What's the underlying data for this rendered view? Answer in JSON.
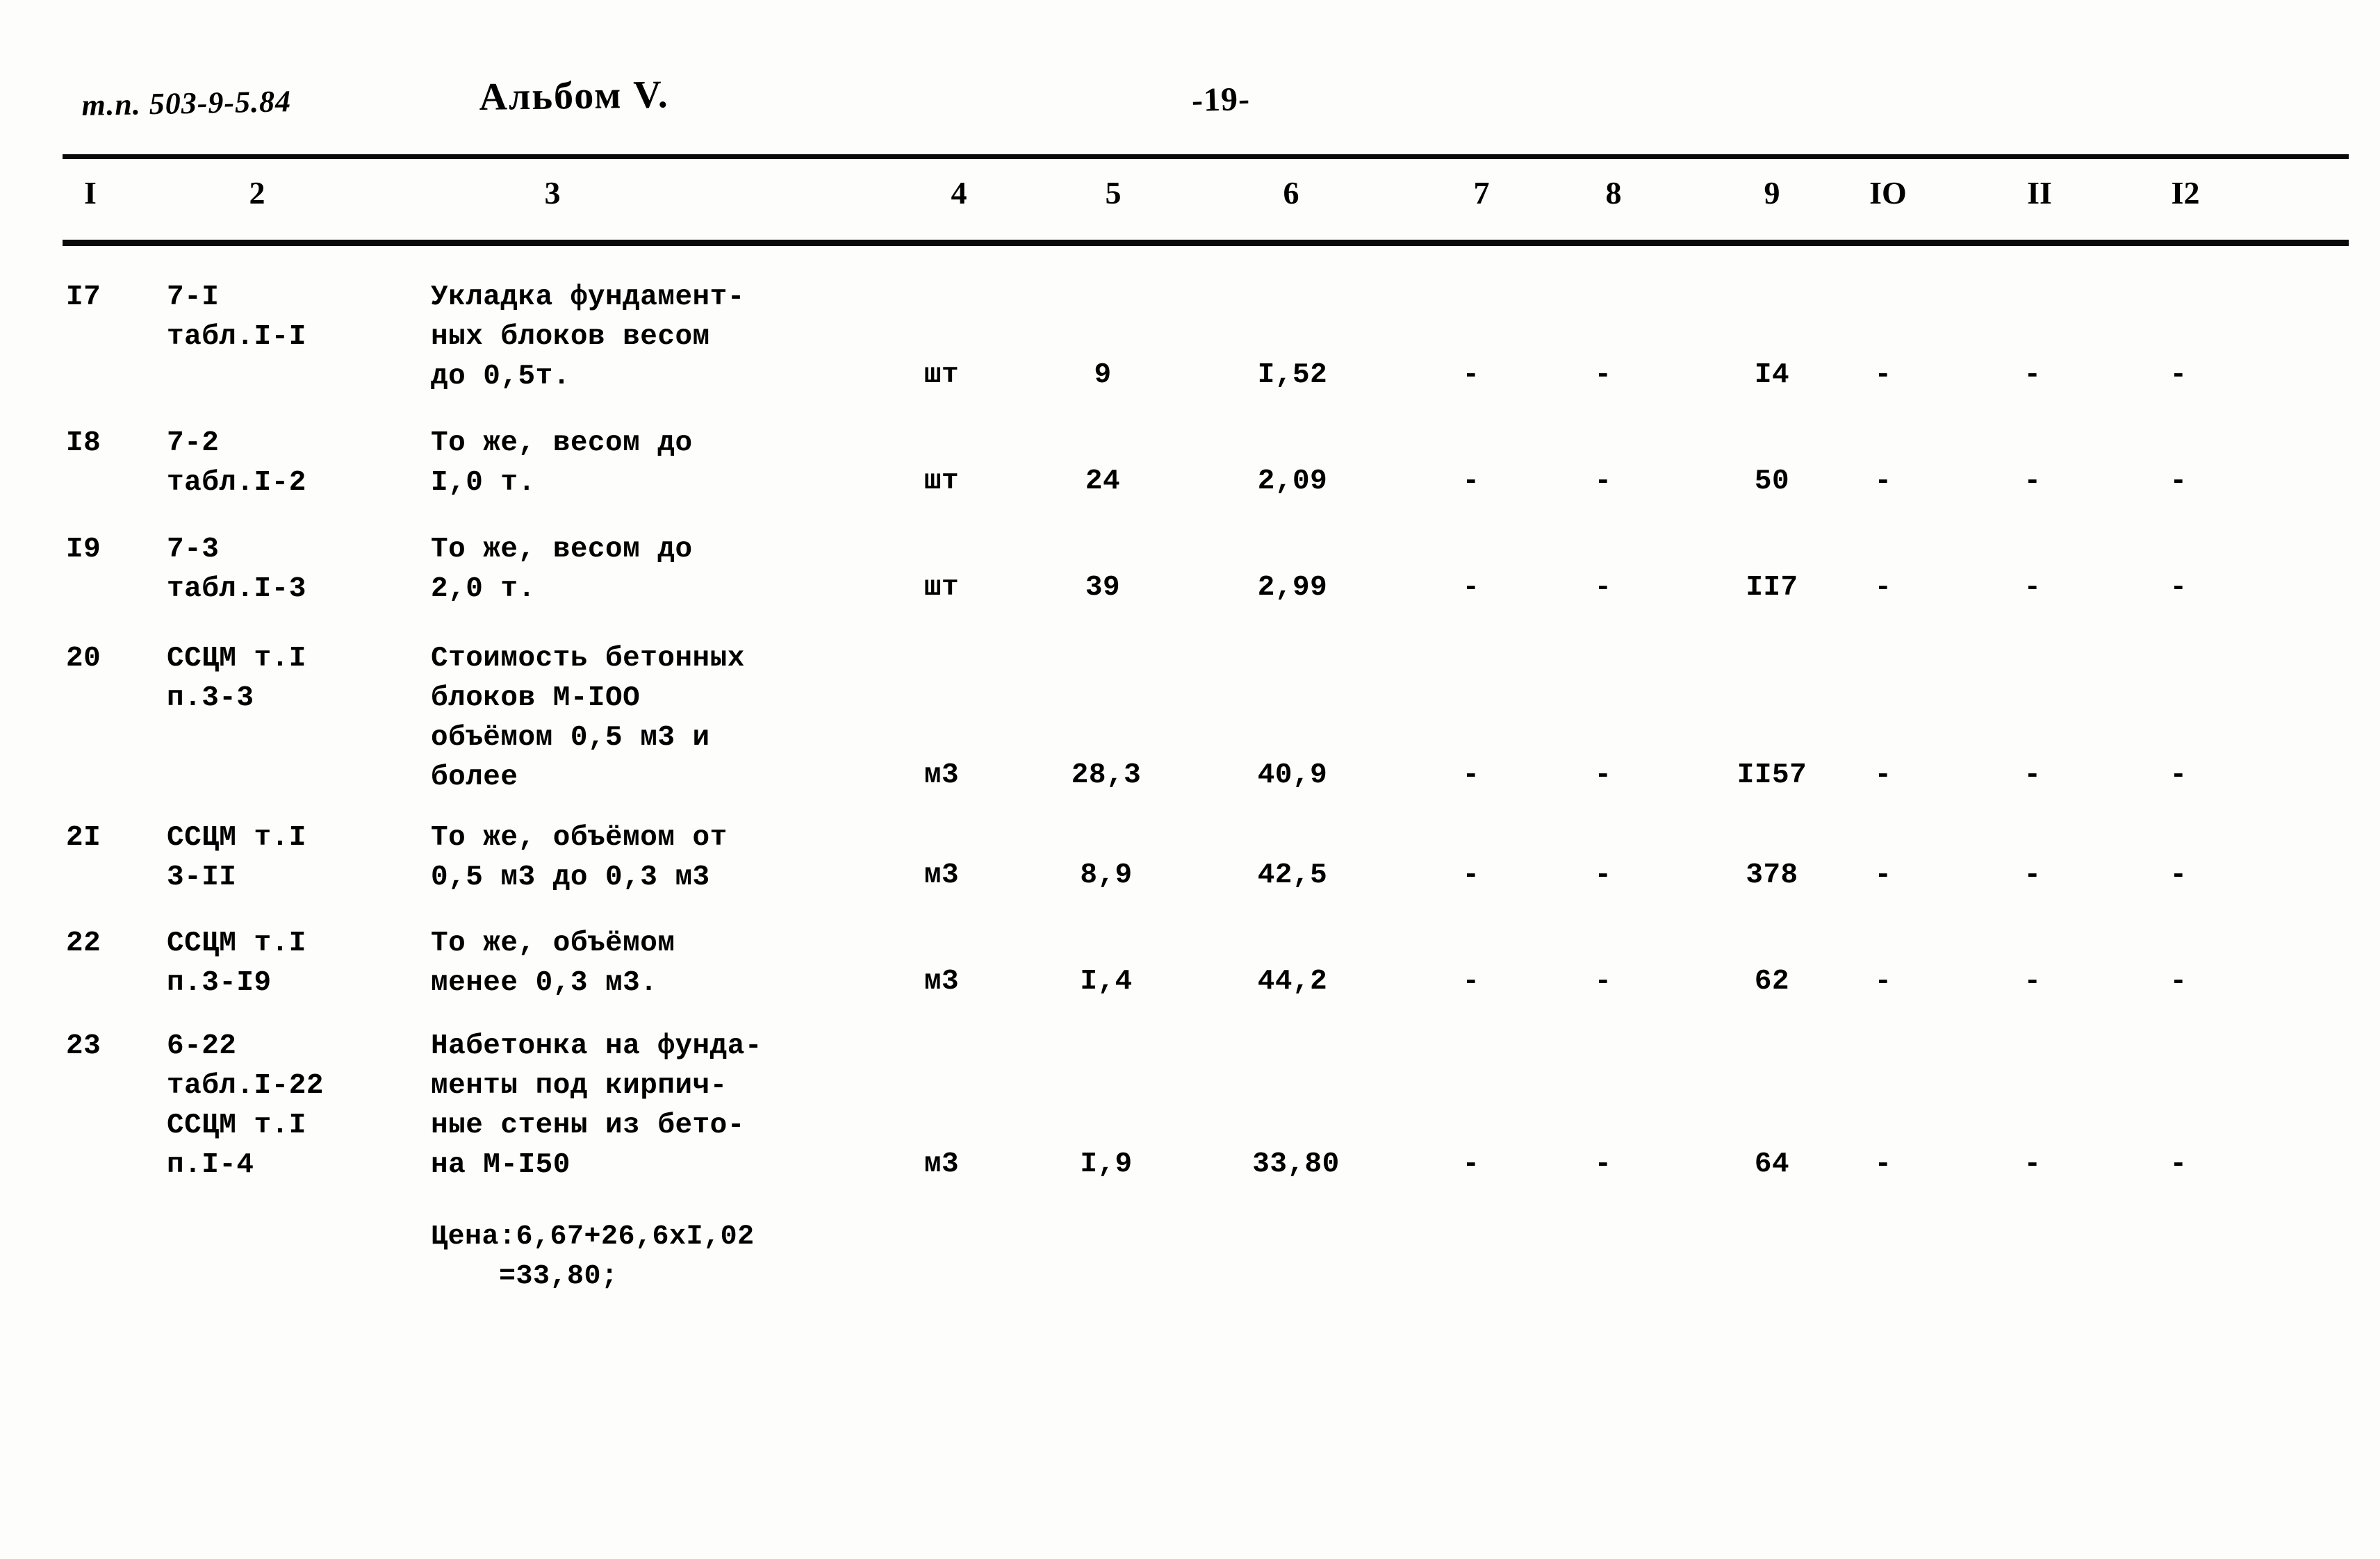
{
  "header": {
    "doc_code": "т.п. 503-9-5.84",
    "album": "Альбом V.",
    "page_number": "-19-"
  },
  "table": {
    "column_headers": [
      "I",
      "2",
      "3",
      "4",
      "5",
      "6",
      "7",
      "8",
      "9",
      "IO",
      "II",
      "I2"
    ],
    "rows": [
      {
        "c1": "I7",
        "c2": [
          "7-I",
          "табл.I-I"
        ],
        "c3": [
          "Укладка фундамент-",
          "ных блоков весом",
          "до 0,5т."
        ],
        "c4": "шт",
        "c5": "9",
        "c6": "I,52",
        "c7": "-",
        "c8": "-",
        "c9": "I4",
        "c10": "-",
        "c11": "-",
        "c12": "-"
      },
      {
        "c1": "I8",
        "c2": [
          "7-2",
          "табл.I-2"
        ],
        "c3": [
          "То же, весом до",
          "I,0 т."
        ],
        "c4": "шт",
        "c5": "24",
        "c6": "2,09",
        "c7": "-",
        "c8": "-",
        "c9": "50",
        "c10": "-",
        "c11": "-",
        "c12": "-"
      },
      {
        "c1": "I9",
        "c2": [
          "7-3",
          "табл.I-3"
        ],
        "c3": [
          "То же, весом до",
          "2,0 т."
        ],
        "c4": "шт",
        "c5": "39",
        "c6": "2,99",
        "c7": "-",
        "c8": "-",
        "c9": "II7",
        "c10": "-",
        "c11": "-",
        "c12": "-"
      },
      {
        "c1": "20",
        "c2": [
          "ССЦМ т.I",
          "п.3-3"
        ],
        "c3": [
          "Стоимость бетонных",
          "блоков М-IOO",
          "объёмом 0,5 м3 и",
          "более"
        ],
        "c4": "м3",
        "c5": "28,3",
        "c6": "40,9",
        "c7": "-",
        "c8": "-",
        "c9": "II57",
        "c10": "-",
        "c11": "-",
        "c12": "-"
      },
      {
        "c1": "2I",
        "c2": [
          "ССЦМ т.I",
          "3-II"
        ],
        "c3": [
          "То же, объёмом от",
          "0,5 м3 до 0,3 м3"
        ],
        "c4": "м3",
        "c5": "8,9",
        "c6": "42,5",
        "c7": "-",
        "c8": "-",
        "c9": "378",
        "c10": "-",
        "c11": "-",
        "c12": "-"
      },
      {
        "c1": "22",
        "c2": [
          "ССЦМ т.I",
          "п.3-I9"
        ],
        "c3": [
          "То же, объёмом",
          "менее 0,3 м3."
        ],
        "c4": "м3",
        "c5": "I,4",
        "c6": "44,2",
        "c7": "-",
        "c8": "-",
        "c9": "62",
        "c10": "-",
        "c11": "-",
        "c12": "-"
      },
      {
        "c1": "23",
        "c2": [
          "6-22",
          "табл.I-22",
          "ССЦМ т.I",
          "п.I-4"
        ],
        "c3": [
          "Набетонка на фунда-",
          "менты под кирпич-",
          "ные стены из бето-",
          "на М-I50"
        ],
        "c4": "м3",
        "c5": "I,9",
        "c6": "33,80",
        "c7": "-",
        "c8": "-",
        "c9": "64",
        "c10": "-",
        "c11": "-",
        "c12": "-"
      }
    ],
    "footnote": [
      "Цена:6,67+26,6хI,02",
      "    =33,80;"
    ]
  }
}
